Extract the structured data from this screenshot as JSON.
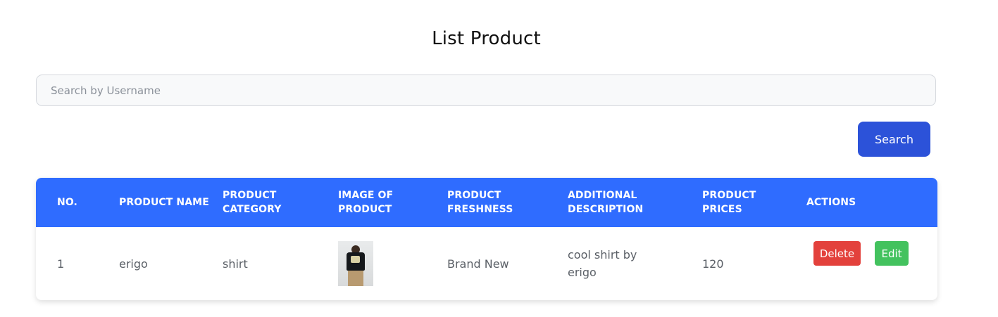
{
  "page": {
    "title": "List Product"
  },
  "search": {
    "placeholder": "Search by Username",
    "value": "",
    "button_label": "Search"
  },
  "table": {
    "headers": [
      "NO.",
      "PRODUCT NAME",
      "PRODUCT CATEGORY",
      "IMAGE OF PRODUCT",
      "PRODUCT FRESHNESS",
      "ADDITIONAL DESCRIPTION",
      "PRODUCT PRICES",
      "ACTIONS"
    ],
    "rows": [
      {
        "no": "1",
        "name": "erigo",
        "category": "shirt",
        "image": "product-thumbnail-shirt",
        "freshness": "Brand New",
        "description": "cool shirt by erigo",
        "price": "120",
        "actions": {
          "delete_label": "Delete",
          "edit_label": "Edit"
        }
      }
    ]
  },
  "colors": {
    "header_bg": "#2f6cff",
    "search_button": "#2c52d9",
    "delete_button": "#e3413c",
    "edit_button": "#43c25e"
  }
}
